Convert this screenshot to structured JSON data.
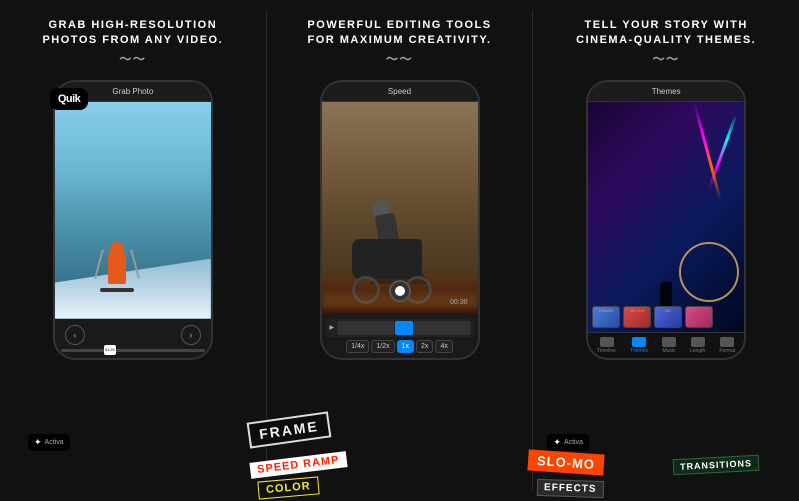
{
  "panels": [
    {
      "id": "panel-1",
      "heading_line1": "GRAB HIGH-RESOLUTION",
      "heading_line2": "PHOTOS FROM ANY VIDEO.",
      "phone_title": "Grab Photo",
      "quik_label": "Quik",
      "timestamp": "01:21"
    },
    {
      "id": "panel-2",
      "heading_line1": "POWERFUL EDITING TOOLS",
      "heading_line2": "FOR MAXIMUM CREATIVITY.",
      "phone_title": "Speed",
      "timestamp": "00:30",
      "speed_buttons": [
        "1/4x",
        "1/2x",
        "1x",
        "2x",
        "4x"
      ]
    },
    {
      "id": "panel-3",
      "heading_line1": "TELL YOUR STORY WITH",
      "heading_line2": "CINEMA-QUALITY THEMES.",
      "phone_title": "Themes",
      "bottom_tabs": [
        {
          "label": "Timeline",
          "active": false
        },
        {
          "label": "Themes",
          "active": true
        },
        {
          "label": "Music",
          "active": false
        },
        {
          "label": "Length",
          "active": false
        },
        {
          "label": "Format",
          "active": false
        }
      ]
    }
  ],
  "stickers": {
    "frame": "FRAME",
    "speed_ramp": "SPEED RAMP",
    "color": "COLOR",
    "slomo": "SLO-MO",
    "effects": "EFFECTS",
    "transitions": "TRANSITIONS"
  },
  "activa_labels": [
    "Activa",
    "Activa"
  ],
  "colors": {
    "bg": "#111111",
    "accent": "#0088ff",
    "panel_divider": "#2a2a2a"
  }
}
